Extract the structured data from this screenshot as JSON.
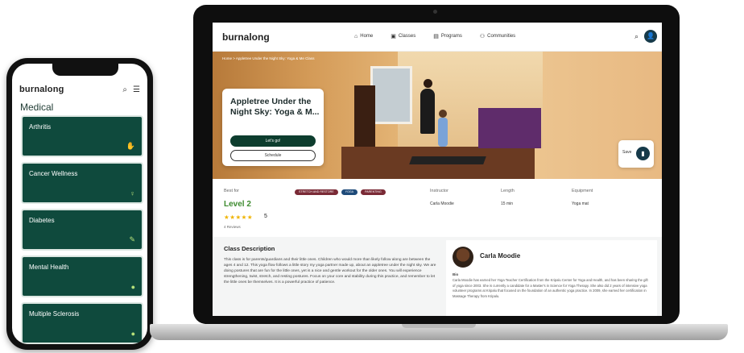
{
  "phone": {
    "logo": "burnalong",
    "section_title": "Medical",
    "categories": [
      {
        "label": "Arthritis",
        "icon": "hands-icon"
      },
      {
        "label": "Cancer Wellness",
        "icon": "ribbon-icon"
      },
      {
        "label": "Diabetes",
        "icon": "syringe-icon"
      },
      {
        "label": "Mental Health",
        "icon": "head-icon"
      },
      {
        "label": "Multiple Sclerosis",
        "icon": "brain-icon"
      }
    ]
  },
  "laptop": {
    "nav": {
      "logo": "burnalong",
      "items": [
        {
          "label": "Home",
          "icon": "home-icon"
        },
        {
          "label": "Classes",
          "icon": "classes-icon"
        },
        {
          "label": "Programs",
          "icon": "programs-icon"
        },
        {
          "label": "Communities",
          "icon": "people-icon"
        }
      ]
    },
    "hero": {
      "breadcrumb": "Home > Appletree Under the Night Sky: Yoga & Me Class",
      "title": "Appletree Under the Night Sky: Yoga & M...",
      "primary_button": "Let's go!",
      "secondary_button": "Schedule",
      "save_label": "Save"
    },
    "info": {
      "best_for_label": "Best for",
      "level": "Level 2",
      "stars": "★★★★★",
      "rating": "5",
      "reviews": "4 Reviews",
      "tags": [
        "STRETCH AND RESTORE",
        "YOGA",
        "PARENTING"
      ],
      "instructor_label": "Instructor",
      "instructor": "Carla Moodie",
      "length_label": "Length",
      "length": "15 min",
      "equipment_label": "Equipment",
      "equipment": "Yoga mat"
    },
    "description": {
      "title": "Class Description",
      "body": "This class is for parents/guardians and their little ones. Children who would more than likely follow along are between the ages 4 and 12. This yoga flow follows a little story my yoga partner made up, about an appletree under the night sky. We are doing postures that are fun for the little ones, yet is a nice and gentle workout for the older ones. You will experience strengthening, twist, stretch, and resting postures. Focus on your core and stability during this practice, and remember to let the little ones be themselves. It is a powerful practice of patience."
    },
    "instructor_card": {
      "name": "Carla Moodie",
      "bio_label": "Bio",
      "bio": "Carla Moodie has earned her Yoga Teacher Certification from the Kripalu Center for Yoga and Health, and has been sharing the gift of yoga since 2003. She is currently a candidate for a Master's in Science for Yoga Therapy. She also did 2 years of intensive yoga volunteer programs at Kripalu that focused on the foundation of an authentic yoga practice. In 2009, she earned her certification in Massage Therapy from Kripalu."
    }
  }
}
